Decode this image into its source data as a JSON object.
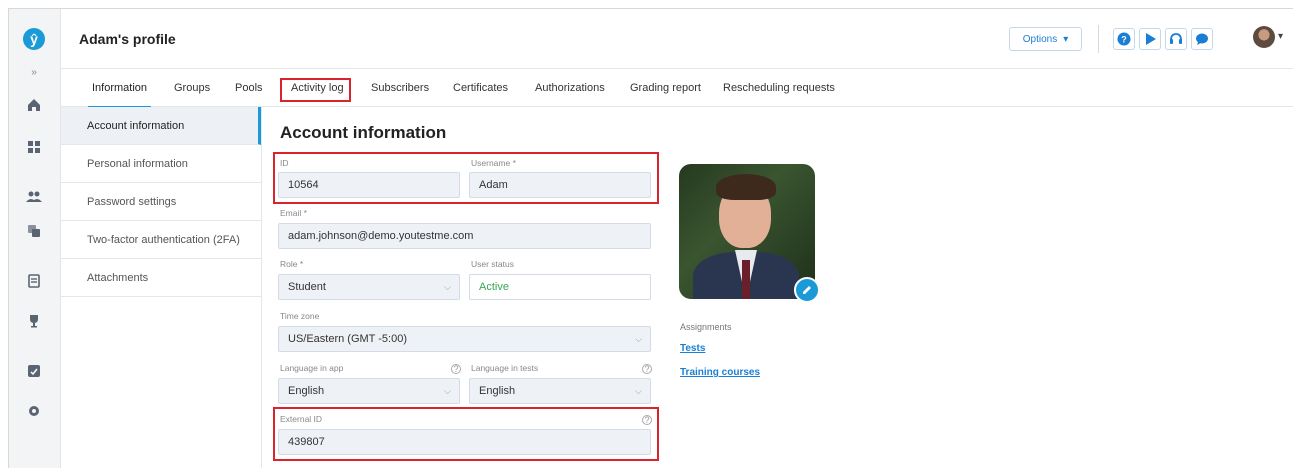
{
  "header": {
    "title": "Adam's profile",
    "options_label": "Options"
  },
  "tabs": [
    "Information",
    "Groups",
    "Pools",
    "Activity log",
    "Subscribers",
    "Certificates",
    "Authorizations",
    "Grading report",
    "Rescheduling requests"
  ],
  "subnav": [
    "Account information",
    "Personal information",
    "Password settings",
    "Two-factor authentication (2FA)",
    "Attachments"
  ],
  "form": {
    "section_title": "Account information",
    "id": {
      "label": "ID",
      "value": "10564"
    },
    "username": {
      "label": "Username *",
      "value": "Adam"
    },
    "email": {
      "label": "Email *",
      "value": "adam.johnson@demo.youtestme.com"
    },
    "role": {
      "label": "Role *",
      "value": "Student"
    },
    "user_status": {
      "label": "User status",
      "value": "Active"
    },
    "time_zone": {
      "label": "Time zone",
      "value": "US/Eastern (GMT -5:00)"
    },
    "language_app": {
      "label": "Language in app",
      "value": "English"
    },
    "language_tests": {
      "label": "Language in tests",
      "value": "English"
    },
    "external_id": {
      "label": "External ID",
      "value": "439807"
    }
  },
  "assignments": {
    "title": "Assignments",
    "links": [
      "Tests",
      "Training courses"
    ]
  },
  "icons": {
    "expand": "»",
    "help": "?",
    "caret": "▾",
    "chevron": "⌵"
  },
  "colors": {
    "accent": "#1a9ad6",
    "highlight": "#d9232d",
    "status_active": "#35a853"
  }
}
